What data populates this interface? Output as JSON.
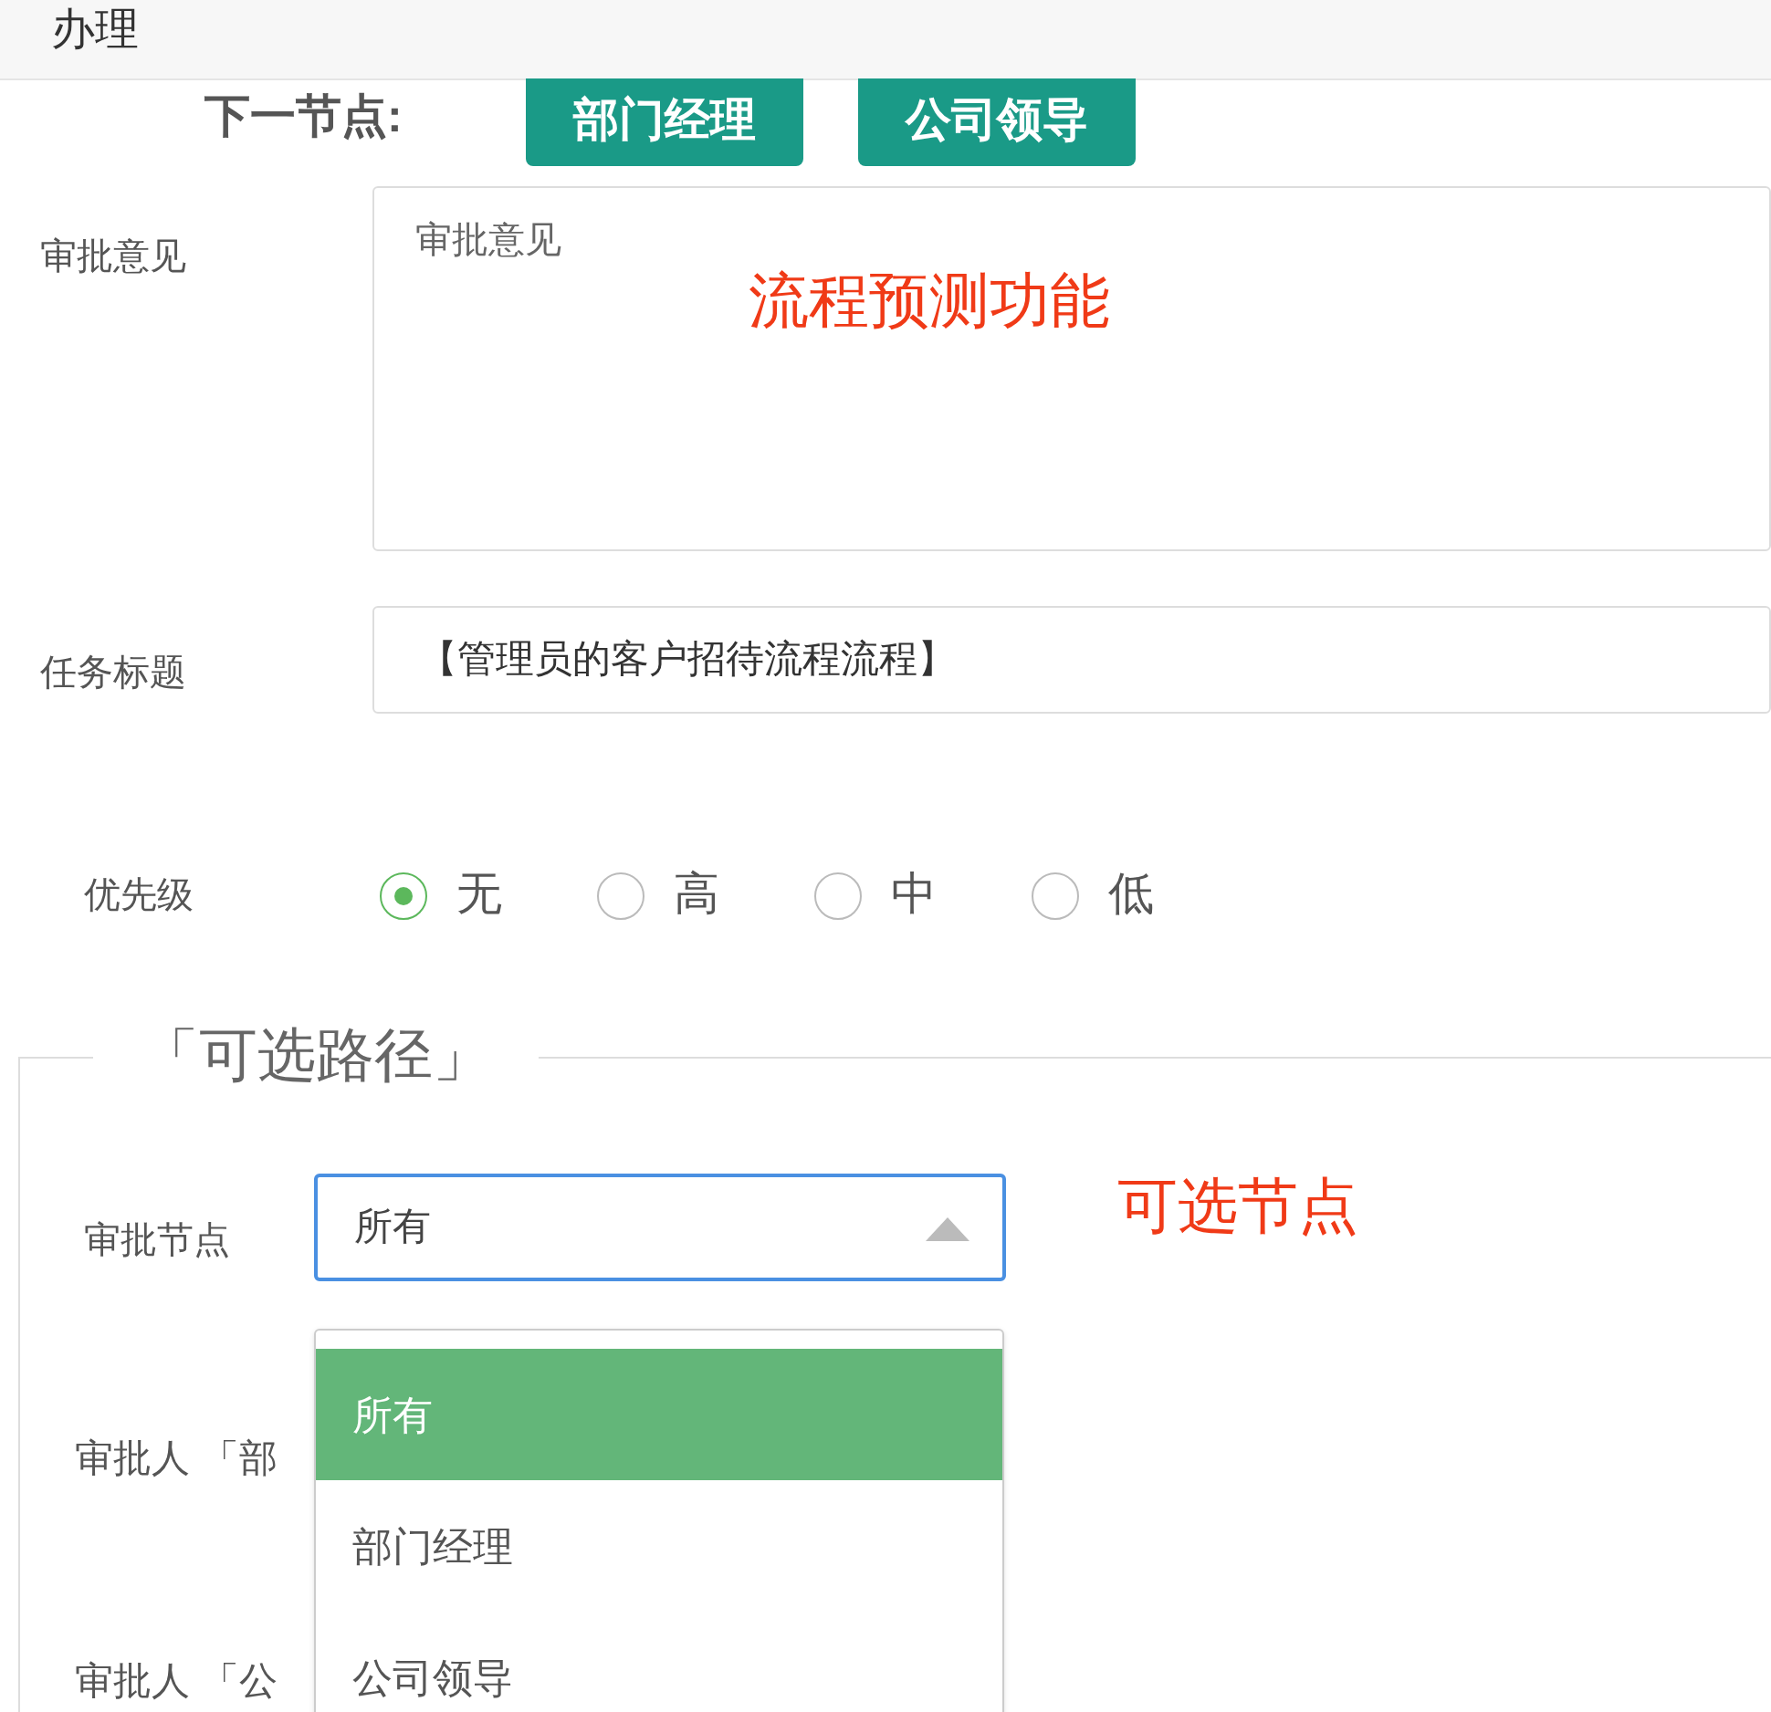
{
  "header": {
    "title": "办理"
  },
  "next_node": {
    "label": "下一节点:",
    "buttons": [
      "部门经理",
      "公司领导"
    ]
  },
  "opinion": {
    "label": "审批意见",
    "placeholder": "审批意见"
  },
  "task_title": {
    "label": "任务标题",
    "value": "【管理员的客户招待流程流程】"
  },
  "priority": {
    "label": "优先级",
    "options": [
      {
        "label": "无",
        "selected": true
      },
      {
        "label": "高",
        "selected": false
      },
      {
        "label": "中",
        "selected": false
      },
      {
        "label": "低",
        "selected": false
      }
    ]
  },
  "optional_path": {
    "legend": "「可选路径」",
    "node_select": {
      "label": "审批节点",
      "value": "所有",
      "expanded": true,
      "options": [
        {
          "label": "所有",
          "selected": true
        },
        {
          "label": "部门经理",
          "selected": false
        },
        {
          "label": "公司领导",
          "selected": false
        }
      ]
    },
    "approvers": [
      {
        "label": "审批人 「部"
      },
      {
        "label": "审批人 「公"
      }
    ]
  },
  "annotations": [
    {
      "text": "流程预测功能"
    },
    {
      "text": "可选节点"
    }
  ]
}
